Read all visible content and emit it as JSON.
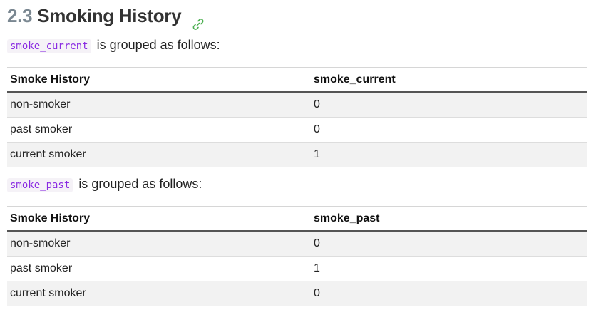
{
  "section": {
    "number": "2.3",
    "title": "Smoking History",
    "anchor_icon": "link-icon",
    "anchor_color": "#4caf50"
  },
  "groups": [
    {
      "variable": "smoke_current",
      "intro_suffix": "is grouped as follows:",
      "columns": [
        "Smoke History",
        "smoke_current"
      ],
      "rows": [
        [
          "non-smoker",
          "0"
        ],
        [
          "past smoker",
          "0"
        ],
        [
          "current smoker",
          "1"
        ]
      ]
    },
    {
      "variable": "smoke_past",
      "intro_suffix": "is grouped as follows:",
      "columns": [
        "Smoke History",
        "smoke_past"
      ],
      "rows": [
        [
          "non-smoker",
          "0"
        ],
        [
          "past smoker",
          "1"
        ],
        [
          "current smoker",
          "0"
        ]
      ]
    }
  ],
  "colors": {
    "code_text": "#8a2be2",
    "code_bg": "#f5f2f7",
    "stripe": "#f2f2f2"
  }
}
